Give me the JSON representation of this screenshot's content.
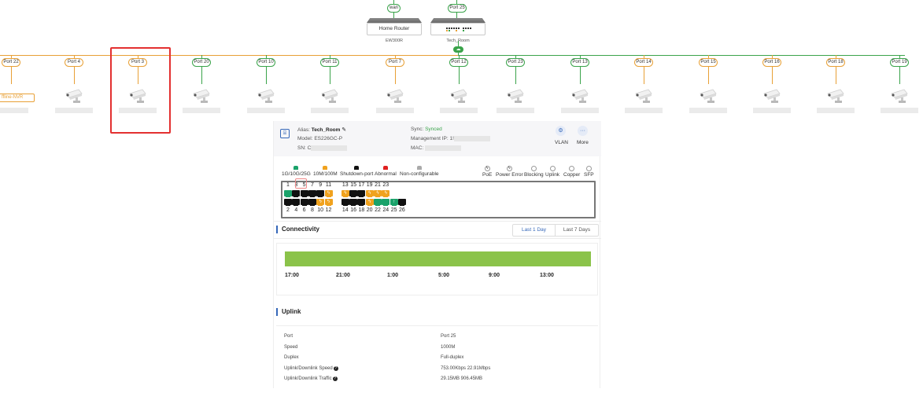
{
  "topology": {
    "upper": [
      {
        "label": "wan",
        "color": "green"
      },
      {
        "label": "Port 25",
        "color": "green"
      }
    ],
    "devices": [
      {
        "name": "Home Router",
        "caption": "EW300R"
      },
      {
        "name": "",
        "caption": "Tech_Room"
      }
    ],
    "ports": [
      {
        "label": "Port 22",
        "color": "orange"
      },
      {
        "label": "Port 4",
        "color": "orange"
      },
      {
        "label": "Port 3",
        "color": "orange"
      },
      {
        "label": "Port 20",
        "color": "green"
      },
      {
        "label": "Port 10",
        "color": "green"
      },
      {
        "label": "Port 11",
        "color": "green"
      },
      {
        "label": "Port 7",
        "color": "orange"
      },
      {
        "label": "Port 12",
        "color": "green"
      },
      {
        "label": "Port 23",
        "color": "green"
      },
      {
        "label": "Port 13",
        "color": "green"
      },
      {
        "label": "Port 14",
        "color": "orange"
      },
      {
        "label": "Port 15",
        "color": "orange"
      },
      {
        "label": "Port 16",
        "color": "orange"
      },
      {
        "label": "Port 18",
        "color": "orange"
      },
      {
        "label": "Port 19",
        "color": "green"
      }
    ],
    "nvr_label": "ffline-NVR",
    "uplink_icon": "cloud-icon",
    "colors": {
      "green": "#3aa34a",
      "orange": "#e8a036",
      "highlight": "#e33030"
    }
  },
  "device_info": {
    "alias_label": "Alias:",
    "alias": "Tech_Room",
    "model_label": "Model:",
    "model": "ES226GC-P",
    "sn_label": "SN:",
    "sn": "C",
    "sync_label": "Sync:",
    "sync": "Synced",
    "mgmt_ip_label": "Management IP:",
    "mgmt_ip": "1!",
    "mac_label": "MAC:",
    "mac": "",
    "vlan_label": "VLAN",
    "more_label": "More"
  },
  "legend": {
    "status": [
      {
        "label": "1G/10G/25G",
        "color": "#1aa26a"
      },
      {
        "label": "10M/100M",
        "color": "#f0a21e"
      },
      {
        "label": "Shutdown-port",
        "color": "#111111"
      },
      {
        "label": "Abnormal",
        "color": "#e02020"
      },
      {
        "label": "Non-configurable",
        "color": "#aaaaaa"
      }
    ],
    "types": [
      "PoE",
      "Power Error",
      "Blocking",
      "Uplink",
      "Copper",
      "SFP"
    ]
  },
  "port_panel": {
    "top_numbers": [
      "1",
      "3",
      "5",
      "7",
      "9",
      "11",
      "13",
      "15",
      "17",
      "19",
      "21",
      "23"
    ],
    "bottom_numbers": [
      "2",
      "4",
      "6",
      "8",
      "10",
      "12",
      "14",
      "16",
      "18",
      "20",
      "22",
      "24",
      "25",
      "26"
    ],
    "top_states": [
      "green",
      "black",
      "black",
      "black",
      "black",
      "orange",
      "orange",
      "black",
      "black",
      "orange",
      "orange",
      "orange"
    ],
    "bottom_states": [
      "black",
      "black",
      "black",
      "black",
      "orange",
      "orange",
      "black",
      "black",
      "black",
      "orange",
      "green",
      "green",
      "green",
      "black"
    ]
  },
  "connectivity": {
    "title": "Connectivity",
    "tabs": [
      "Last 1 Day",
      "Last 7 Days"
    ],
    "active_tab": 0,
    "ticks": [
      "17:00",
      "21:00",
      "1:00",
      "5:00",
      "9:00",
      "13:00"
    ],
    "status_color": "#8bc34a"
  },
  "uplink": {
    "title": "Uplink",
    "rows": [
      {
        "label": "Port",
        "value": "Port 25"
      },
      {
        "label": "Speed",
        "value": "1000M"
      },
      {
        "label": "Duplex",
        "value": "Full-duplex"
      },
      {
        "label": "Uplink/Downlink Speed",
        "value": "753.00Kbps 22.91Mbps"
      },
      {
        "label": "Uplink/Downlink Traffic",
        "value": "29.15MB 906.45MB"
      }
    ]
  }
}
